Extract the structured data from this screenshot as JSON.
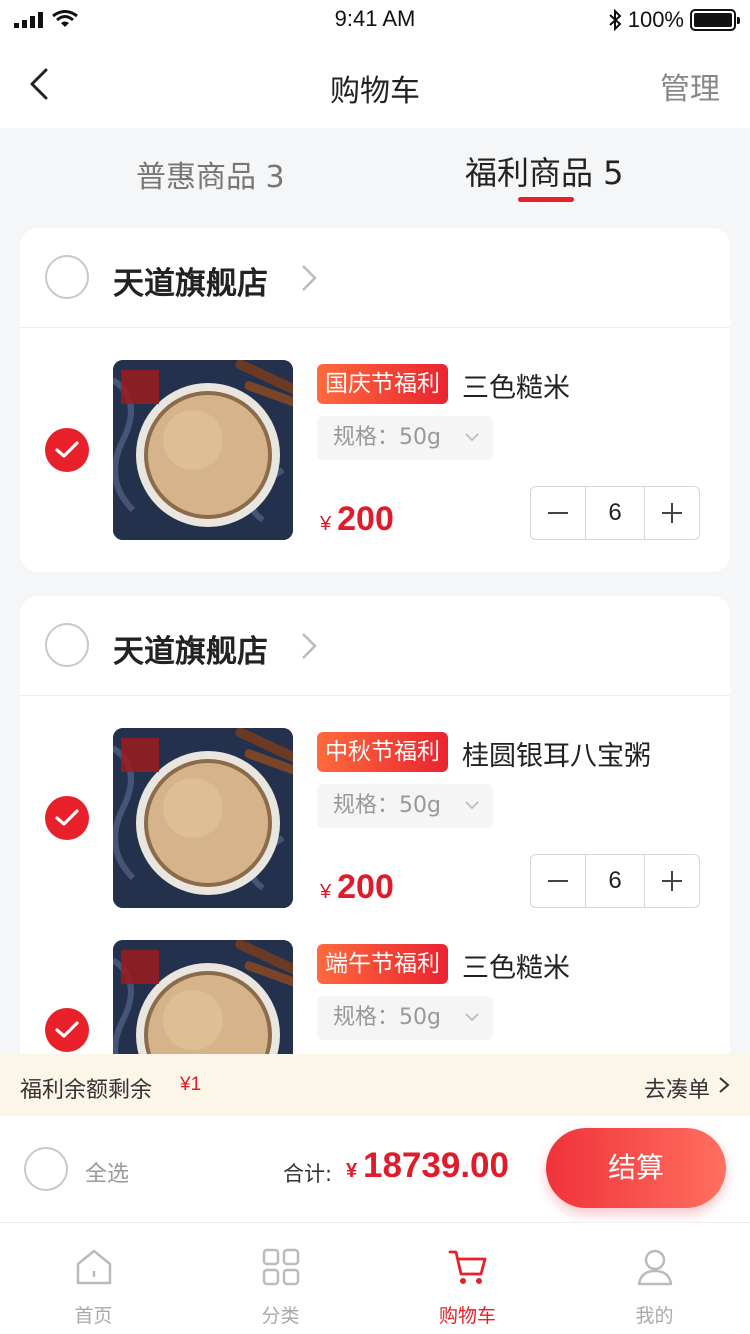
{
  "status_bar": {
    "time": "9:41 AM",
    "battery": "100%",
    "battery_level": 1.0
  },
  "nav": {
    "title": "购物车",
    "manage_label": "管理"
  },
  "tabs": [
    {
      "label": "普惠商品 3",
      "active": false
    },
    {
      "label": "福利商品  5",
      "active": true
    }
  ],
  "stores": [
    {
      "name": "天道旗舰店",
      "items": [
        {
          "tag": "国庆节福利",
          "name": "三色糙米",
          "spec": "规格：50g",
          "price_symbol": "¥",
          "price": "200",
          "quantity": "6",
          "checked": true
        }
      ]
    },
    {
      "name": "天道旗舰店",
      "items": [
        {
          "tag": "中秋节福利",
          "name": "桂圆银耳八宝粥",
          "spec": "规格：50g",
          "price_symbol": "¥",
          "price": "200",
          "quantity": "6",
          "checked": true
        },
        {
          "tag": "端午节福利",
          "name": "三色糙米",
          "spec": "规格：50g",
          "checked": true
        }
      ]
    }
  ],
  "welfare_bar": {
    "label": "福利余额剩余",
    "amount": "¥1",
    "link": "去凑单"
  },
  "checkout": {
    "select_all": "全选",
    "total_label": "合计:",
    "total_symbol": "¥",
    "total_value": "18739.00",
    "pay_label": "结算"
  },
  "tabbar": [
    {
      "label": "首页",
      "icon": "home-icon",
      "active": false
    },
    {
      "label": "分类",
      "icon": "category-grid-icon",
      "active": false
    },
    {
      "label": "购物车",
      "icon": "cart-icon",
      "active": true
    },
    {
      "label": "我的",
      "icon": "profile-icon",
      "active": false
    }
  ],
  "colors": {
    "accent": "#e8202a",
    "price": "#e01c2b",
    "welfare_bg": "#fbf6e7"
  }
}
